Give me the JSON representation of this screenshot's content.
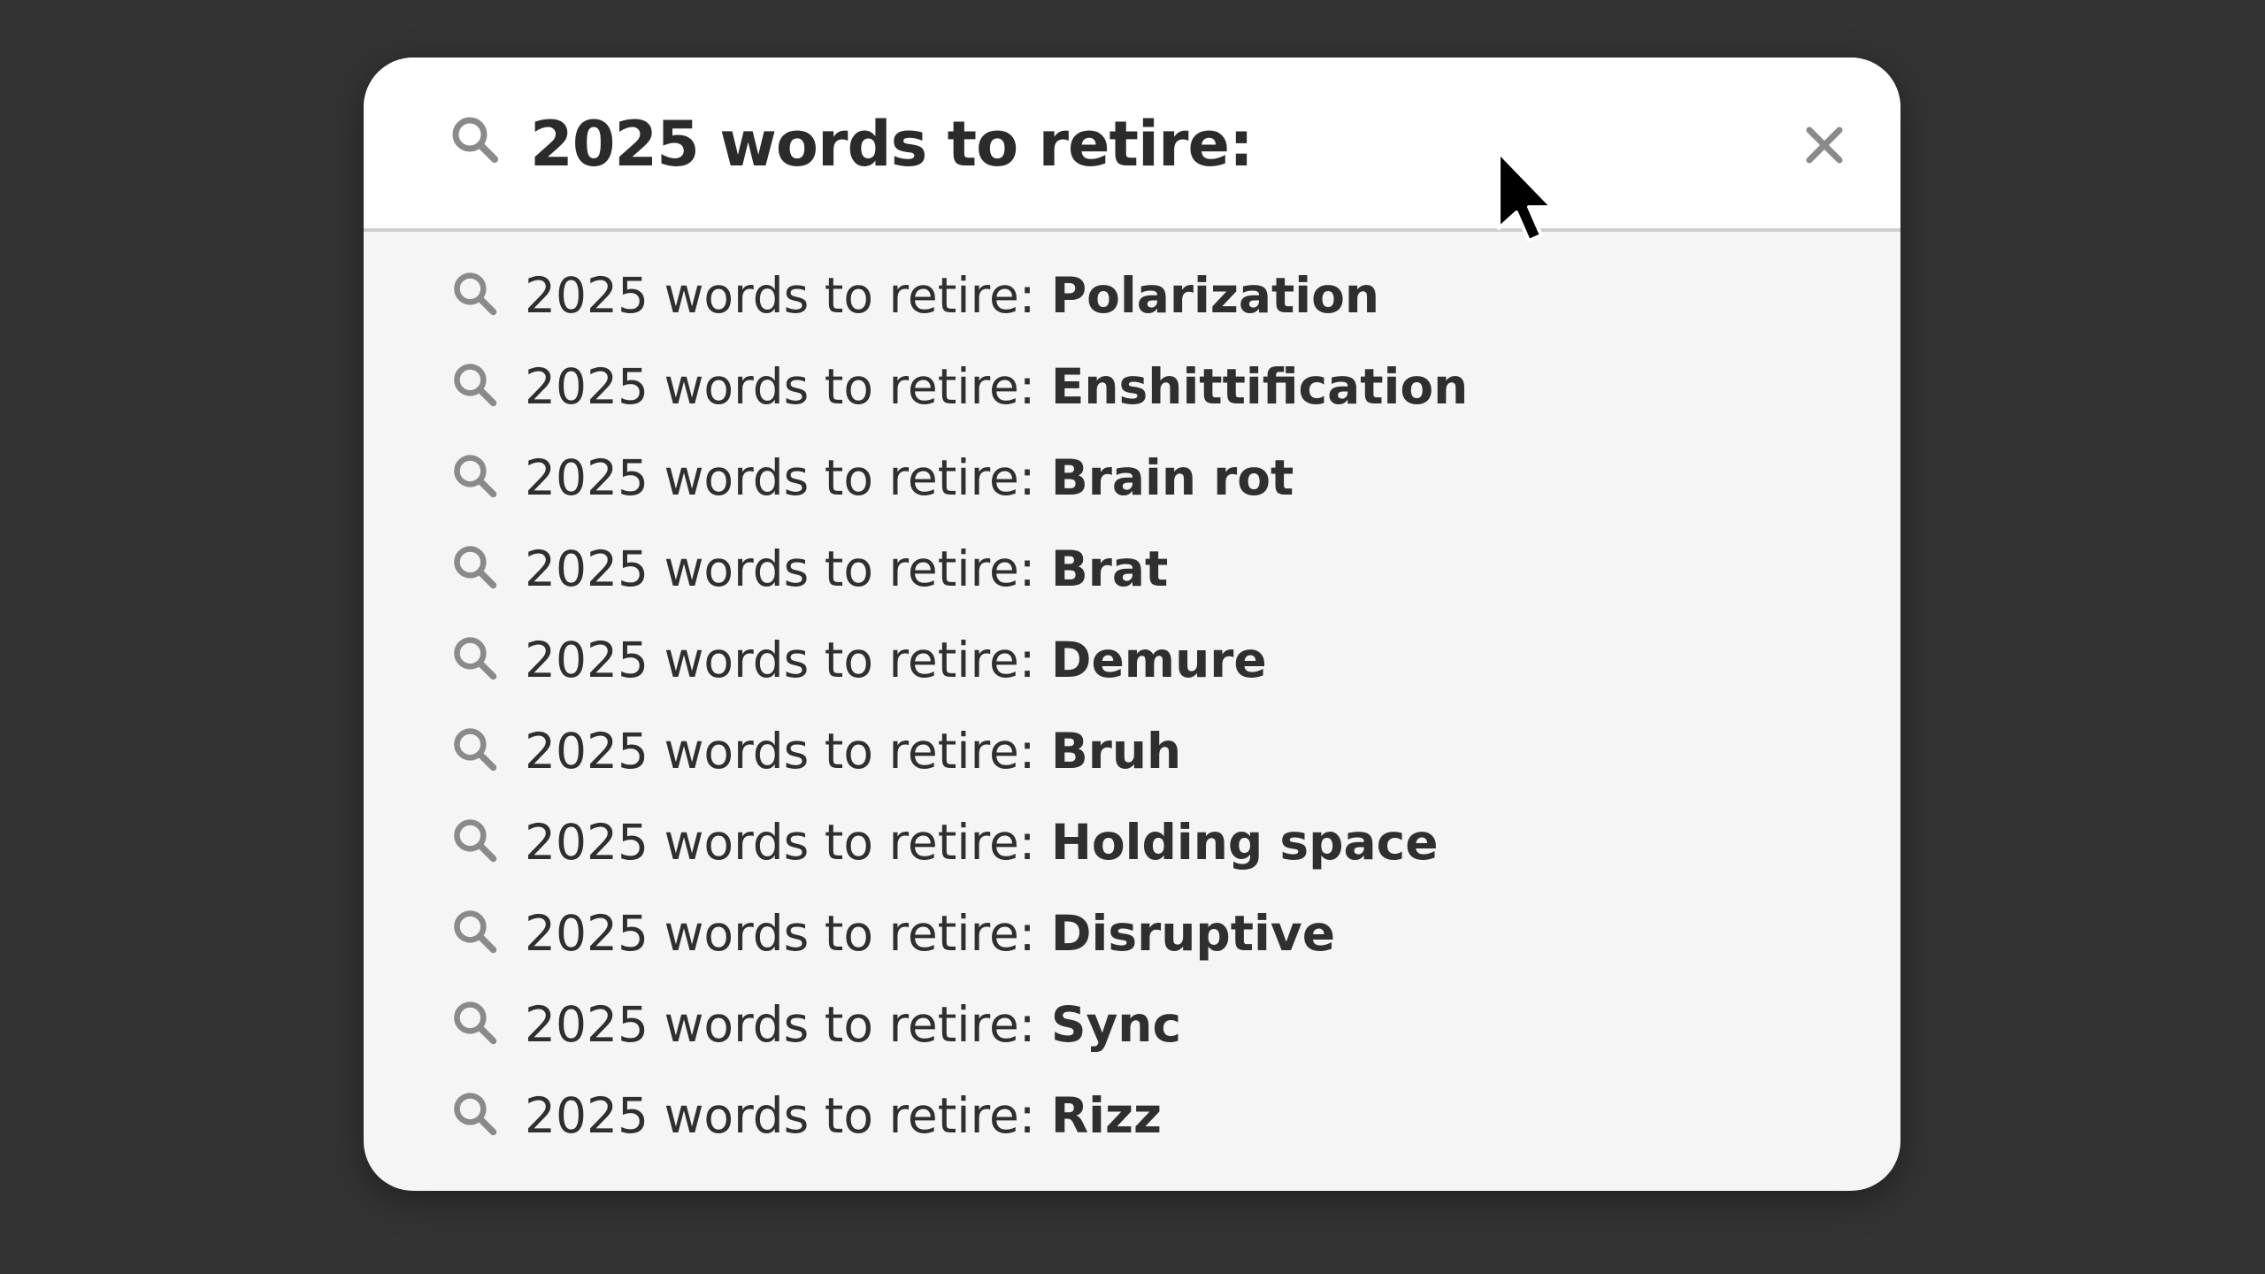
{
  "search": {
    "query": "2025 words to retire:",
    "icon": "search-icon",
    "clear_icon": "close-icon"
  },
  "suggestions": [
    {
      "prefix": "2025 words to retire: ",
      "term": "Polarization"
    },
    {
      "prefix": "2025 words to retire: ",
      "term": "Enshittification"
    },
    {
      "prefix": "2025 words to retire: ",
      "term": "Brain rot"
    },
    {
      "prefix": "2025 words to retire: ",
      "term": "Brat"
    },
    {
      "prefix": "2025 words to retire: ",
      "term": "Demure"
    },
    {
      "prefix": "2025 words to retire: ",
      "term": "Bruh"
    },
    {
      "prefix": "2025 words to retire: ",
      "term": "Holding space"
    },
    {
      "prefix": "2025 words to retire: ",
      "term": "Disruptive"
    },
    {
      "prefix": "2025 words to retire: ",
      "term": "Sync"
    },
    {
      "prefix": "2025 words to retire: ",
      "term": "Rizz"
    }
  ],
  "colors": {
    "background": "#333333",
    "card": "#f5f5f5",
    "search_bar": "#ffffff",
    "text": "#2b2b2b",
    "icon": "#8a8a8a"
  }
}
